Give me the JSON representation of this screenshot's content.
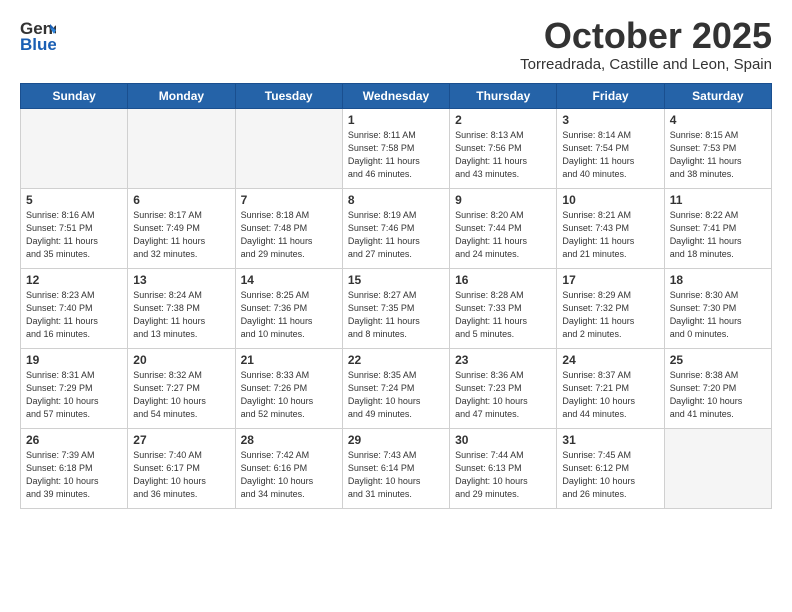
{
  "header": {
    "logo_line1": "General",
    "logo_line2": "Blue",
    "month": "October 2025",
    "location": "Torreadrada, Castille and Leon, Spain"
  },
  "weekdays": [
    "Sunday",
    "Monday",
    "Tuesday",
    "Wednesday",
    "Thursday",
    "Friday",
    "Saturday"
  ],
  "weeks": [
    [
      {
        "day": "",
        "info": ""
      },
      {
        "day": "",
        "info": ""
      },
      {
        "day": "",
        "info": ""
      },
      {
        "day": "1",
        "info": "Sunrise: 8:11 AM\nSunset: 7:58 PM\nDaylight: 11 hours\nand 46 minutes."
      },
      {
        "day": "2",
        "info": "Sunrise: 8:13 AM\nSunset: 7:56 PM\nDaylight: 11 hours\nand 43 minutes."
      },
      {
        "day": "3",
        "info": "Sunrise: 8:14 AM\nSunset: 7:54 PM\nDaylight: 11 hours\nand 40 minutes."
      },
      {
        "day": "4",
        "info": "Sunrise: 8:15 AM\nSunset: 7:53 PM\nDaylight: 11 hours\nand 38 minutes."
      }
    ],
    [
      {
        "day": "5",
        "info": "Sunrise: 8:16 AM\nSunset: 7:51 PM\nDaylight: 11 hours\nand 35 minutes."
      },
      {
        "day": "6",
        "info": "Sunrise: 8:17 AM\nSunset: 7:49 PM\nDaylight: 11 hours\nand 32 minutes."
      },
      {
        "day": "7",
        "info": "Sunrise: 8:18 AM\nSunset: 7:48 PM\nDaylight: 11 hours\nand 29 minutes."
      },
      {
        "day": "8",
        "info": "Sunrise: 8:19 AM\nSunset: 7:46 PM\nDaylight: 11 hours\nand 27 minutes."
      },
      {
        "day": "9",
        "info": "Sunrise: 8:20 AM\nSunset: 7:44 PM\nDaylight: 11 hours\nand 24 minutes."
      },
      {
        "day": "10",
        "info": "Sunrise: 8:21 AM\nSunset: 7:43 PM\nDaylight: 11 hours\nand 21 minutes."
      },
      {
        "day": "11",
        "info": "Sunrise: 8:22 AM\nSunset: 7:41 PM\nDaylight: 11 hours\nand 18 minutes."
      }
    ],
    [
      {
        "day": "12",
        "info": "Sunrise: 8:23 AM\nSunset: 7:40 PM\nDaylight: 11 hours\nand 16 minutes."
      },
      {
        "day": "13",
        "info": "Sunrise: 8:24 AM\nSunset: 7:38 PM\nDaylight: 11 hours\nand 13 minutes."
      },
      {
        "day": "14",
        "info": "Sunrise: 8:25 AM\nSunset: 7:36 PM\nDaylight: 11 hours\nand 10 minutes."
      },
      {
        "day": "15",
        "info": "Sunrise: 8:27 AM\nSunset: 7:35 PM\nDaylight: 11 hours\nand 8 minutes."
      },
      {
        "day": "16",
        "info": "Sunrise: 8:28 AM\nSunset: 7:33 PM\nDaylight: 11 hours\nand 5 minutes."
      },
      {
        "day": "17",
        "info": "Sunrise: 8:29 AM\nSunset: 7:32 PM\nDaylight: 11 hours\nand 2 minutes."
      },
      {
        "day": "18",
        "info": "Sunrise: 8:30 AM\nSunset: 7:30 PM\nDaylight: 11 hours\nand 0 minutes."
      }
    ],
    [
      {
        "day": "19",
        "info": "Sunrise: 8:31 AM\nSunset: 7:29 PM\nDaylight: 10 hours\nand 57 minutes."
      },
      {
        "day": "20",
        "info": "Sunrise: 8:32 AM\nSunset: 7:27 PM\nDaylight: 10 hours\nand 54 minutes."
      },
      {
        "day": "21",
        "info": "Sunrise: 8:33 AM\nSunset: 7:26 PM\nDaylight: 10 hours\nand 52 minutes."
      },
      {
        "day": "22",
        "info": "Sunrise: 8:35 AM\nSunset: 7:24 PM\nDaylight: 10 hours\nand 49 minutes."
      },
      {
        "day": "23",
        "info": "Sunrise: 8:36 AM\nSunset: 7:23 PM\nDaylight: 10 hours\nand 47 minutes."
      },
      {
        "day": "24",
        "info": "Sunrise: 8:37 AM\nSunset: 7:21 PM\nDaylight: 10 hours\nand 44 minutes."
      },
      {
        "day": "25",
        "info": "Sunrise: 8:38 AM\nSunset: 7:20 PM\nDaylight: 10 hours\nand 41 minutes."
      }
    ],
    [
      {
        "day": "26",
        "info": "Sunrise: 7:39 AM\nSunset: 6:18 PM\nDaylight: 10 hours\nand 39 minutes."
      },
      {
        "day": "27",
        "info": "Sunrise: 7:40 AM\nSunset: 6:17 PM\nDaylight: 10 hours\nand 36 minutes."
      },
      {
        "day": "28",
        "info": "Sunrise: 7:42 AM\nSunset: 6:16 PM\nDaylight: 10 hours\nand 34 minutes."
      },
      {
        "day": "29",
        "info": "Sunrise: 7:43 AM\nSunset: 6:14 PM\nDaylight: 10 hours\nand 31 minutes."
      },
      {
        "day": "30",
        "info": "Sunrise: 7:44 AM\nSunset: 6:13 PM\nDaylight: 10 hours\nand 29 minutes."
      },
      {
        "day": "31",
        "info": "Sunrise: 7:45 AM\nSunset: 6:12 PM\nDaylight: 10 hours\nand 26 minutes."
      },
      {
        "day": "",
        "info": ""
      }
    ]
  ]
}
